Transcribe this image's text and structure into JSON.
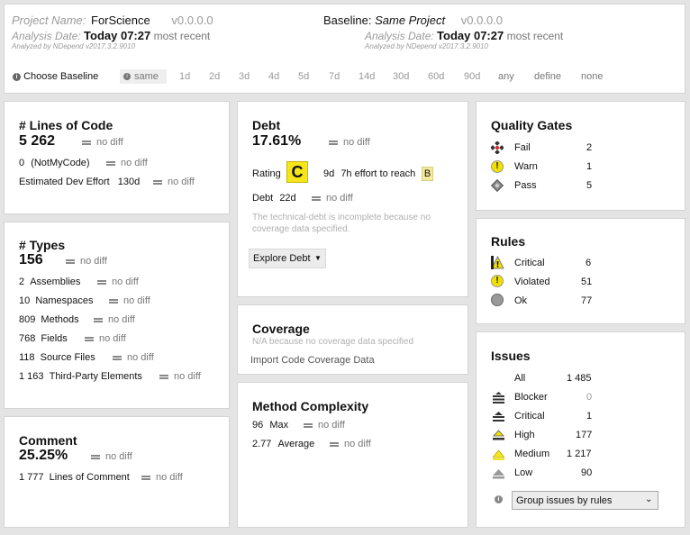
{
  "header": {
    "project_name_label": "Project Name:",
    "project_name": "ForScience",
    "version": "v0.0.0.0",
    "analysis_date_label": "Analysis Date:",
    "analysis_date": "Today 07:27",
    "most_recent": "most recent",
    "analyzed_by": "Analyzed by NDepend v2017.3.2.9010",
    "baseline_label": "Baseline:",
    "baseline_name": "Same Project",
    "baseline_version": "v0.0.0.0",
    "baseline_analysis_date_label": "Analysis Date:",
    "baseline_analysis_date": "Today 07:27",
    "baseline_most_recent": "most recent",
    "baseline_analyzed_by": "Analyzed by NDepend v2017.3.2.9010",
    "choose_baseline": "Choose Baseline",
    "baseline_options": [
      "same",
      "1d",
      "2d",
      "3d",
      "4d",
      "5d",
      "7d",
      "14d",
      "30d",
      "60d",
      "90d",
      "any",
      "define",
      "none"
    ]
  },
  "no_diff": "no diff",
  "loc": {
    "title": "# Lines of Code",
    "value": "5 262",
    "notmycode_value": "0",
    "notmycode_label": "(NotMyCode)",
    "dev_effort_label": "Estimated Dev Effort",
    "dev_effort_value": "130d"
  },
  "types": {
    "title": "# Types",
    "value": "156",
    "rows": [
      {
        "value": "2",
        "label": "Assemblies"
      },
      {
        "value": "10",
        "label": "Namespaces"
      },
      {
        "value": "809",
        "label": "Methods"
      },
      {
        "value": "768",
        "label": "Fields"
      },
      {
        "value": "118",
        "label": "Source Files"
      },
      {
        "value": "1 163",
        "label": "Third-Party Elements"
      }
    ]
  },
  "comment": {
    "title": "Comment",
    "value": "25.25%",
    "lines_value": "1 777",
    "lines_label": "Lines of Comment"
  },
  "debt": {
    "title": "Debt",
    "value": "17.61%",
    "rating_label": "Rating",
    "rating": "C",
    "effort_days": "9d",
    "effort_hours": "7h",
    "effort_text": "effort to reach",
    "target_rating": "B",
    "debt_label": "Debt",
    "debt_value": "22d",
    "note": "The technical-debt is incomplete because no coverage data specified.",
    "explore_button": "Explore Debt",
    "accent": "#f5e61a"
  },
  "coverage": {
    "title": "Coverage",
    "na_text": "N/A because no coverage data specified",
    "import_link": "Import Code Coverage Data"
  },
  "complexity": {
    "title": "Method Complexity",
    "max_value": "96",
    "max_label": "Max",
    "avg_value": "2.77",
    "avg_label": "Average"
  },
  "quality_gates": {
    "title": "Quality Gates",
    "rows": [
      {
        "label": "Fail",
        "count": "2",
        "icon": "fail-icon"
      },
      {
        "label": "Warn",
        "count": "1",
        "icon": "warn-icon"
      },
      {
        "label": "Pass",
        "count": "5",
        "icon": "pass-icon"
      }
    ]
  },
  "rules": {
    "title": "Rules",
    "rows": [
      {
        "label": "Critical",
        "count": "6",
        "icon": "critical-rule-icon"
      },
      {
        "label": "Violated",
        "count": "51",
        "icon": "violated-icon"
      },
      {
        "label": "Ok",
        "count": "77",
        "icon": "ok-icon"
      }
    ]
  },
  "issues": {
    "title": "Issues",
    "all_label": "All",
    "all_count": "1 485",
    "rows": [
      {
        "label": "Blocker",
        "count": "0",
        "icon": "blocker-icon"
      },
      {
        "label": "Critical",
        "count": "1",
        "icon": "critical-issue-icon"
      },
      {
        "label": "High",
        "count": "177",
        "icon": "high-icon"
      },
      {
        "label": "Medium",
        "count": "1 217",
        "icon": "medium-icon"
      },
      {
        "label": "Low",
        "count": "90",
        "icon": "low-icon"
      }
    ],
    "group_select": "Group issues by rules"
  }
}
